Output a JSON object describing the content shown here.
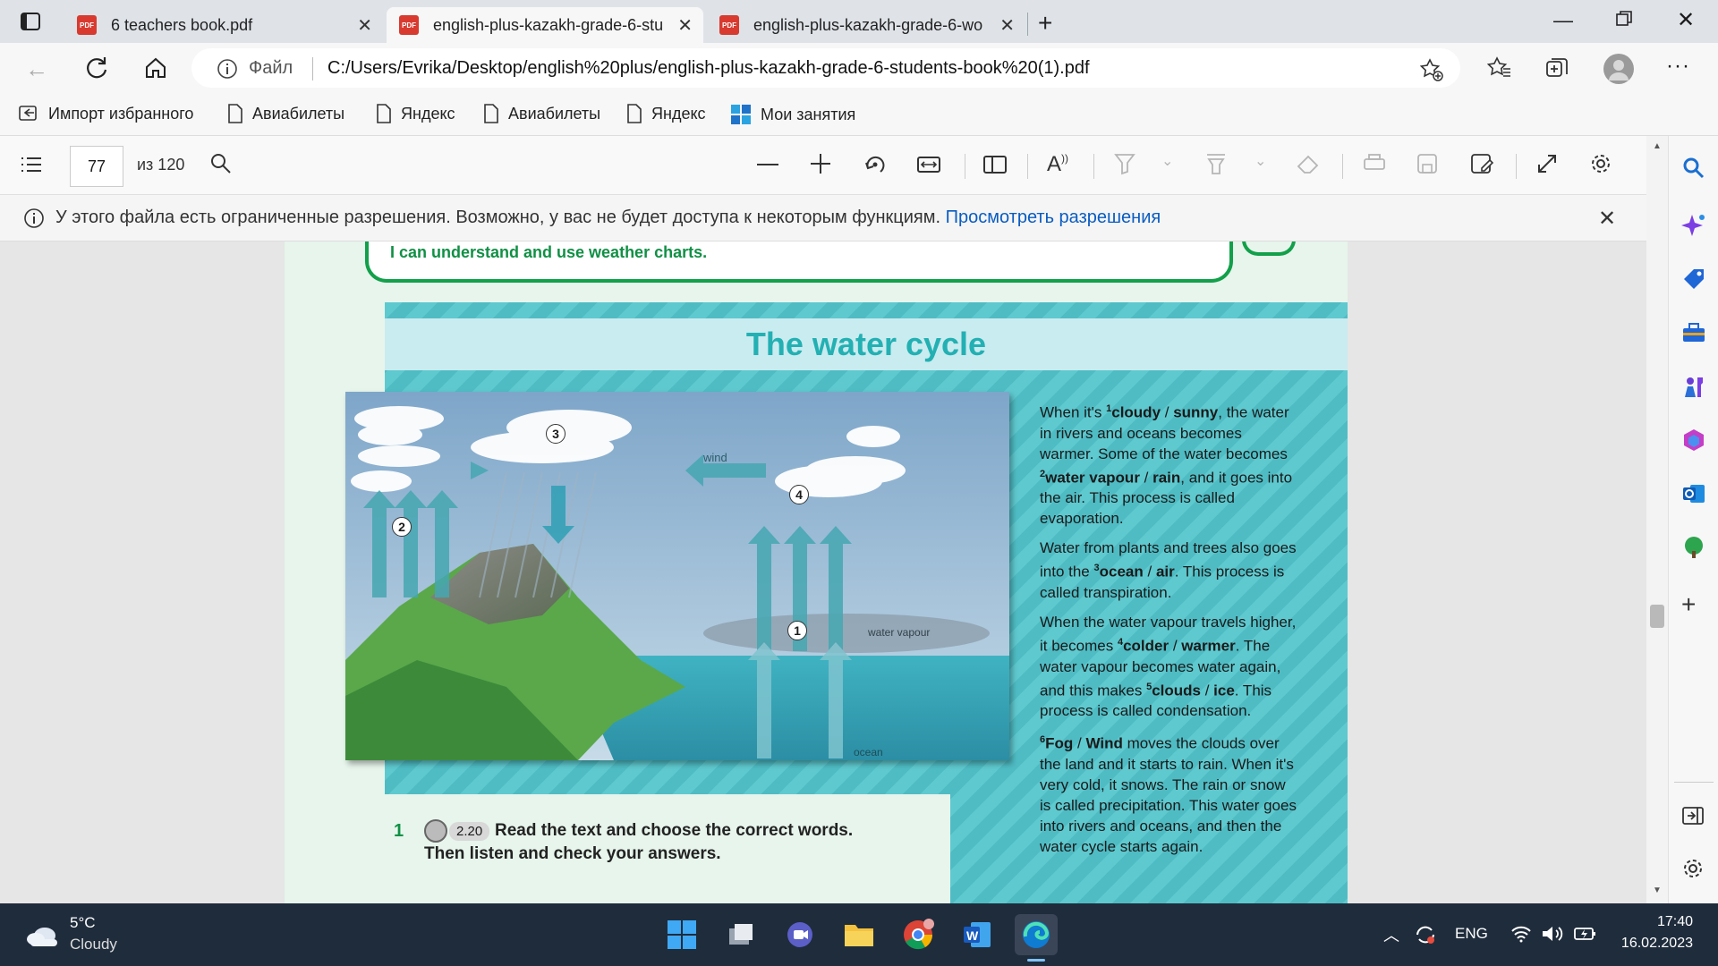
{
  "browser": {
    "tabs": [
      {
        "title": "6 teachers book.pdf",
        "active": false
      },
      {
        "title": "english-plus-kazakh-grade-6-stu",
        "active": true
      },
      {
        "title": "english-plus-kazakh-grade-6-wo",
        "active": false
      }
    ],
    "pdf_badge": "PDF",
    "address": {
      "scheme_label": "Файл",
      "url": "C:/Users/Evrika/Desktop/english%20plus/english-plus-kazakh-grade-6-students-book%20(1).pdf"
    },
    "favorites": [
      "Импорт избранного",
      "Авиабилеты",
      "Яндекс",
      "Авиабилеты",
      "Яндекс",
      "Мои занятия"
    ]
  },
  "pdf_toolbar": {
    "page_number": "77",
    "page_total": "из 120"
  },
  "info_bar": {
    "message": "У этого файла есть ограниченные разрешения. Возможно, у вас не будет доступа к некоторым функциям.",
    "link": "Просмотреть разрешения"
  },
  "document": {
    "goal_text": "I can understand and use weather charts.",
    "banner_title": "The water cycle",
    "diagram_labels": {
      "wind": "wind",
      "water_vapour": "water vapour",
      "ocean": "ocean",
      "n1": "1",
      "n2": "2",
      "n3": "3",
      "n4": "4"
    },
    "paragraphs": [
      [
        {
          "t": "When it's "
        },
        {
          "sup": "1"
        },
        {
          "b": "cloudy"
        },
        {
          "t": " / "
        },
        {
          "b": "sunny"
        },
        {
          "t": ", the water in rivers and oceans becomes warmer. Some of the water becomes "
        },
        {
          "sup": "2"
        },
        {
          "b": "water vapour"
        },
        {
          "t": " / "
        },
        {
          "b": "rain"
        },
        {
          "t": ", and it goes into the air. This process is called evaporation."
        }
      ],
      [
        {
          "t": "Water from plants and trees also goes into the "
        },
        {
          "sup": "3"
        },
        {
          "b": "ocean"
        },
        {
          "t": " / "
        },
        {
          "b": "air"
        },
        {
          "t": ". This process is called transpiration."
        }
      ],
      [
        {
          "t": "When the water vapour travels higher, it becomes "
        },
        {
          "sup": "4"
        },
        {
          "b": "colder"
        },
        {
          "t": " / "
        },
        {
          "b": "warmer"
        },
        {
          "t": ". The water vapour becomes water again, and this makes "
        },
        {
          "sup": "5"
        },
        {
          "b": "clouds"
        },
        {
          "t": " / "
        },
        {
          "b": "ice"
        },
        {
          "t": ". This process is called condensation."
        }
      ],
      [
        {
          "sup": "6"
        },
        {
          "b": "Fog"
        },
        {
          "t": " / "
        },
        {
          "b": "Wind"
        },
        {
          "t": " moves the clouds over the land and it starts to rain. When it's very cold, it snows. The rain or snow is called precipitation. This water goes into rivers and oceans, and then the water cycle starts again."
        }
      ]
    ],
    "exercise": {
      "number": "1",
      "track": "2.20",
      "instruction_line1": "Read the text and choose the correct words.",
      "instruction_line2": "Then listen and check your answers."
    }
  },
  "taskbar": {
    "weather_temp": "5°C",
    "weather_desc": "Cloudy",
    "lang": "ENG",
    "time": "17:40",
    "date": "16.02.2023"
  }
}
